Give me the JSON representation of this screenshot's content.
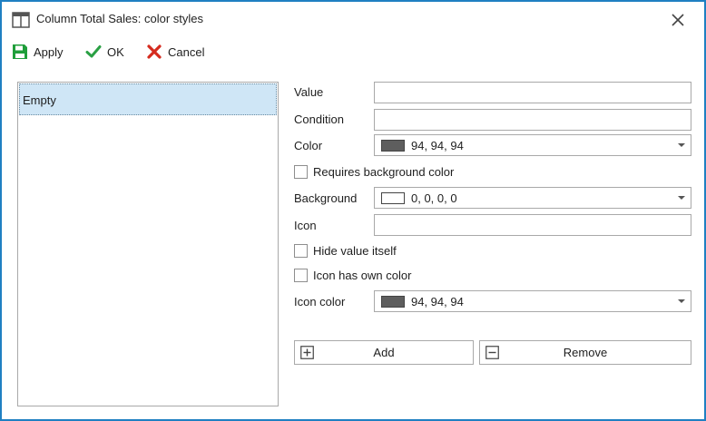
{
  "window": {
    "title": "Column Total Sales: color styles"
  },
  "toolbar": {
    "apply_label": "Apply",
    "ok_label": "OK",
    "cancel_label": "Cancel"
  },
  "list": {
    "items": [
      {
        "label": "Empty",
        "selected": true
      }
    ]
  },
  "form": {
    "value_label": "Value",
    "value": "",
    "condition_label": "Condition",
    "condition": "",
    "color_label": "Color",
    "color_value": "94, 94, 94",
    "color_swatch": "#5e5e5e",
    "requires_bg_label": "Requires background color",
    "requires_bg_checked": false,
    "background_label": "Background",
    "background_value": "0, 0, 0, 0",
    "background_swatch": "#ffffff",
    "icon_label": "Icon",
    "icon_value": "",
    "hide_value_label": "Hide value itself",
    "hide_value_checked": false,
    "icon_own_color_label": "Icon has own color",
    "icon_own_color_checked": false,
    "icon_color_label": "Icon color",
    "icon_color_value": "94, 94, 94",
    "icon_color_swatch": "#5e5e5e"
  },
  "buttons": {
    "add_label": "Add",
    "remove_label": "Remove"
  },
  "colors": {
    "window_border": "#1f7fc2",
    "apply_green": "#1f9e3a",
    "ok_green": "#2aa044",
    "cancel_red": "#d52b1e",
    "selection_bg": "#cfe6f6"
  },
  "icons": {
    "title": "window-columns-icon",
    "close": "close-icon",
    "apply": "save-icon",
    "ok": "checkmark-icon",
    "cancel": "cross-icon",
    "add": "plus-box-icon",
    "remove": "minus-box-icon"
  }
}
